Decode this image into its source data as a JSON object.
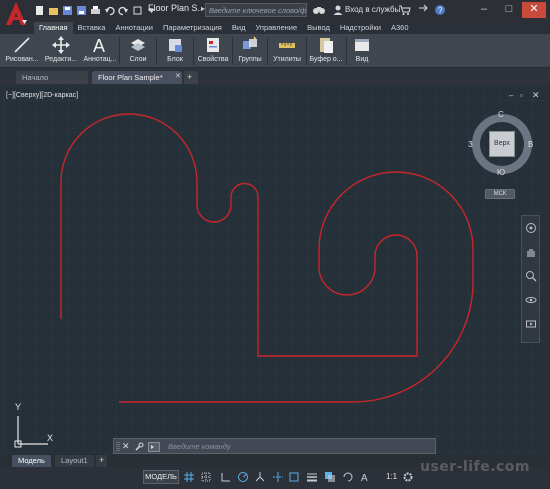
{
  "title_bar": {
    "document_title": "Floor Plan S...",
    "search_placeholder": "Введите ключевое слово/фразу",
    "sign_in": "Вход в службы"
  },
  "ribbon_tabs": [
    {
      "label": "Главная",
      "active": true
    },
    {
      "label": "Вставка"
    },
    {
      "label": "Аннотации"
    },
    {
      "label": "Параметризация"
    },
    {
      "label": "Вид"
    },
    {
      "label": "Управление"
    },
    {
      "label": "Вывод"
    },
    {
      "label": "Надстройки"
    },
    {
      "label": "A360"
    }
  ],
  "ribbon_panels": [
    {
      "label": "Рисован...",
      "icon": "line-icon"
    },
    {
      "label": "Редакти...",
      "icon": "move-icon"
    },
    {
      "label": "Аннотац...",
      "icon": "text-icon"
    },
    {
      "label": "Слои",
      "icon": "layers-icon"
    },
    {
      "label": "Блок",
      "icon": "block-icon"
    },
    {
      "label": "Свойства",
      "icon": "properties-icon"
    },
    {
      "label": "Группы",
      "icon": "groups-icon"
    },
    {
      "label": "Утилиты",
      "icon": "measure-icon"
    },
    {
      "label": "Буфер о...",
      "icon": "clipboard-icon"
    },
    {
      "label": "Вид",
      "icon": "view-icon"
    }
  ],
  "file_tabs": [
    {
      "label": "Начало"
    },
    {
      "label": "Floor Plan Sample*",
      "active": true
    }
  ],
  "viewport": {
    "label": "[−][Сверху][2D-каркас]"
  },
  "viewcube": {
    "face": "Верх",
    "north": "С",
    "south": "Ю",
    "west": "З",
    "east": "В",
    "wcs": "МСК"
  },
  "ucs": {
    "x": "X",
    "y": "Y"
  },
  "command_line": {
    "placeholder": "Введите команду"
  },
  "layout_tabs": [
    {
      "label": "Модель",
      "active": true
    },
    {
      "label": "Layout1"
    }
  ],
  "status_bar": {
    "model": "МОДЕЛЬ",
    "scale": "1:1"
  },
  "watermark": "user-life.com",
  "colors": {
    "canvas": "#263039",
    "polyline": "#c8262b",
    "ribbon": "#3f4650"
  }
}
